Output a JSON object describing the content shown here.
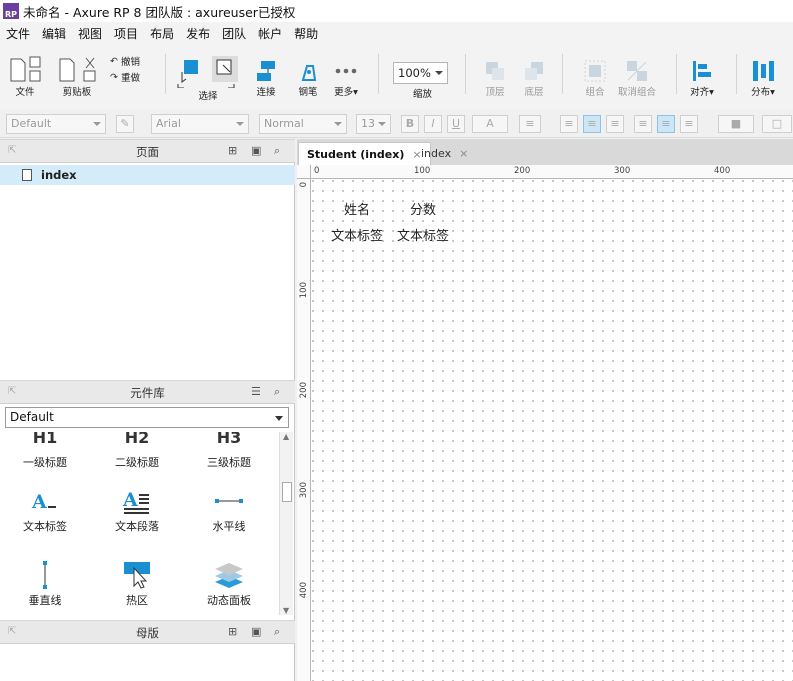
{
  "window": {
    "title": "未命名 - Axure RP 8 团队版 : axureuser已授权",
    "logo": "RP"
  },
  "menu": [
    "文件",
    "编辑",
    "视图",
    "项目",
    "布局",
    "发布",
    "团队",
    "帐户",
    "帮助"
  ],
  "toolbar": {
    "file_label": "文件",
    "clipboard_label": "剪贴板",
    "undo_label": "撤销",
    "redo_label": "重做",
    "select_label": "选择",
    "connect_label": "连接",
    "pen_label": "钢笔",
    "more_label": "更多▾",
    "zoom_value": "100%",
    "zoom_label": "缩放",
    "top_label": "顶层",
    "bottom_label": "底层",
    "group_label": "组合",
    "ungroup_label": "取消组合",
    "align_label": "对齐▾",
    "distribute_label": "分布▾"
  },
  "format": {
    "style": "Default",
    "font": "Arial",
    "weight": "Normal",
    "size": "13",
    "bold": "B",
    "italic": "I",
    "underline": "U",
    "font_color": "A"
  },
  "pages_panel": {
    "title": "页面",
    "items": [
      "index"
    ]
  },
  "library_panel": {
    "title": "元件库",
    "selected": "Default",
    "items": [
      {
        "label": "一级标题",
        "icon": "h1-icon"
      },
      {
        "label": "二级标题",
        "icon": "h2-icon"
      },
      {
        "label": "三级标题",
        "icon": "h3-icon"
      },
      {
        "label": "文本标签",
        "icon": "text-label-icon"
      },
      {
        "label": "文本段落",
        "icon": "paragraph-icon"
      },
      {
        "label": "水平线",
        "icon": "horizontal-line-icon"
      },
      {
        "label": "垂直线",
        "icon": "vertical-line-icon"
      },
      {
        "label": "热区",
        "icon": "hotspot-icon"
      },
      {
        "label": "动态面板",
        "icon": "dynamic-panel-icon"
      }
    ]
  },
  "masters_panel": {
    "title": "母版"
  },
  "tabs": [
    {
      "label": "Student (index)",
      "close": "×"
    },
    {
      "label": "index",
      "close": "×"
    }
  ],
  "ruler": {
    "top": [
      "0",
      "100",
      "200",
      "300",
      "400"
    ],
    "left": [
      "0",
      "100",
      "200",
      "300",
      "400"
    ]
  },
  "canvas": {
    "header1": "姓名",
    "header2": "分数",
    "cell1": "文本标签",
    "cell2": "文本标签"
  },
  "colors": {
    "accent": "#1a8fd1",
    "selection": "#d4ebf9",
    "logo": "#6b3fa0"
  }
}
